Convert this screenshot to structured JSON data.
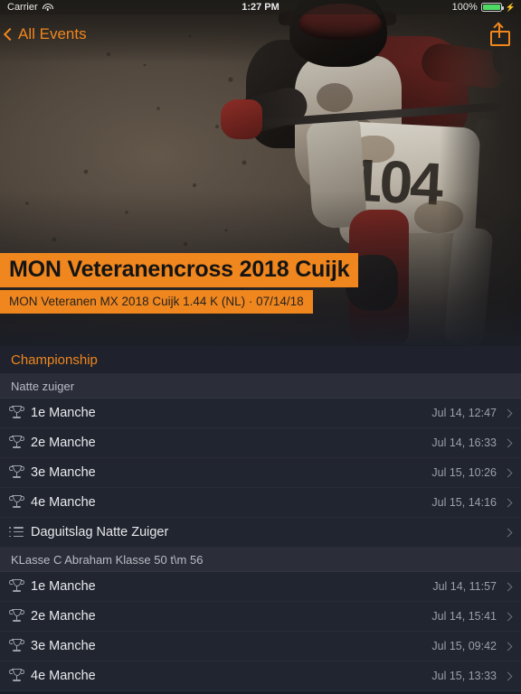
{
  "status_bar": {
    "carrier": "Carrier",
    "wifi_icon": "wifi-icon",
    "time": "1:27 PM",
    "battery_percent": "100%",
    "battery_icon": "battery-full-icon",
    "charging_icon": "lightning-bolt-icon"
  },
  "nav": {
    "back_icon": "chevron-left-icon",
    "back_label": "All Events",
    "share_icon": "share-icon"
  },
  "hero": {
    "photo_alt": "motocross-rider-photo",
    "bike_number": "104",
    "title": "MON Veteranencross 2018 Cuijk",
    "subtitle": "MON Veteranen MX 2018 Cuijk 1.44 K (NL) · 07/14/18"
  },
  "colors": {
    "accent": "#F0861E",
    "list_background": "#1b1e27",
    "row_background": "#212530",
    "section_background": "#2b2e38",
    "battery_green": "#4cd964"
  },
  "list": {
    "header": "Championship",
    "sections": [
      {
        "title": "Natte zuiger",
        "rows": [
          {
            "icon": "trophy-icon",
            "label": "1e Manche",
            "timestamp": "Jul 14, 12:47",
            "disclosure": "chevron-right-icon"
          },
          {
            "icon": "trophy-icon",
            "label": "2e Manche",
            "timestamp": "Jul 14, 16:33",
            "disclosure": "chevron-right-icon"
          },
          {
            "icon": "trophy-icon",
            "label": "3e Manche",
            "timestamp": "Jul 15, 10:26",
            "disclosure": "chevron-right-icon"
          },
          {
            "icon": "trophy-icon",
            "label": "4e Manche",
            "timestamp": "Jul 15, 14:16",
            "disclosure": "chevron-right-icon"
          },
          {
            "icon": "list-icon",
            "label": "Daguitslag Natte Zuiger",
            "timestamp": "",
            "disclosure": "chevron-right-icon"
          }
        ]
      },
      {
        "title": "KLasse C Abraham Klasse 50 t\\m 56",
        "rows": [
          {
            "icon": "trophy-icon",
            "label": "1e Manche",
            "timestamp": "Jul 14, 11:57",
            "disclosure": "chevron-right-icon"
          },
          {
            "icon": "trophy-icon",
            "label": "2e Manche",
            "timestamp": "Jul 14, 15:41",
            "disclosure": "chevron-right-icon"
          },
          {
            "icon": "trophy-icon",
            "label": "3e Manche",
            "timestamp": "Jul 15, 09:42",
            "disclosure": "chevron-right-icon"
          },
          {
            "icon": "trophy-icon",
            "label": "4e Manche",
            "timestamp": "Jul 15, 13:33",
            "disclosure": "chevron-right-icon"
          }
        ]
      }
    ]
  }
}
